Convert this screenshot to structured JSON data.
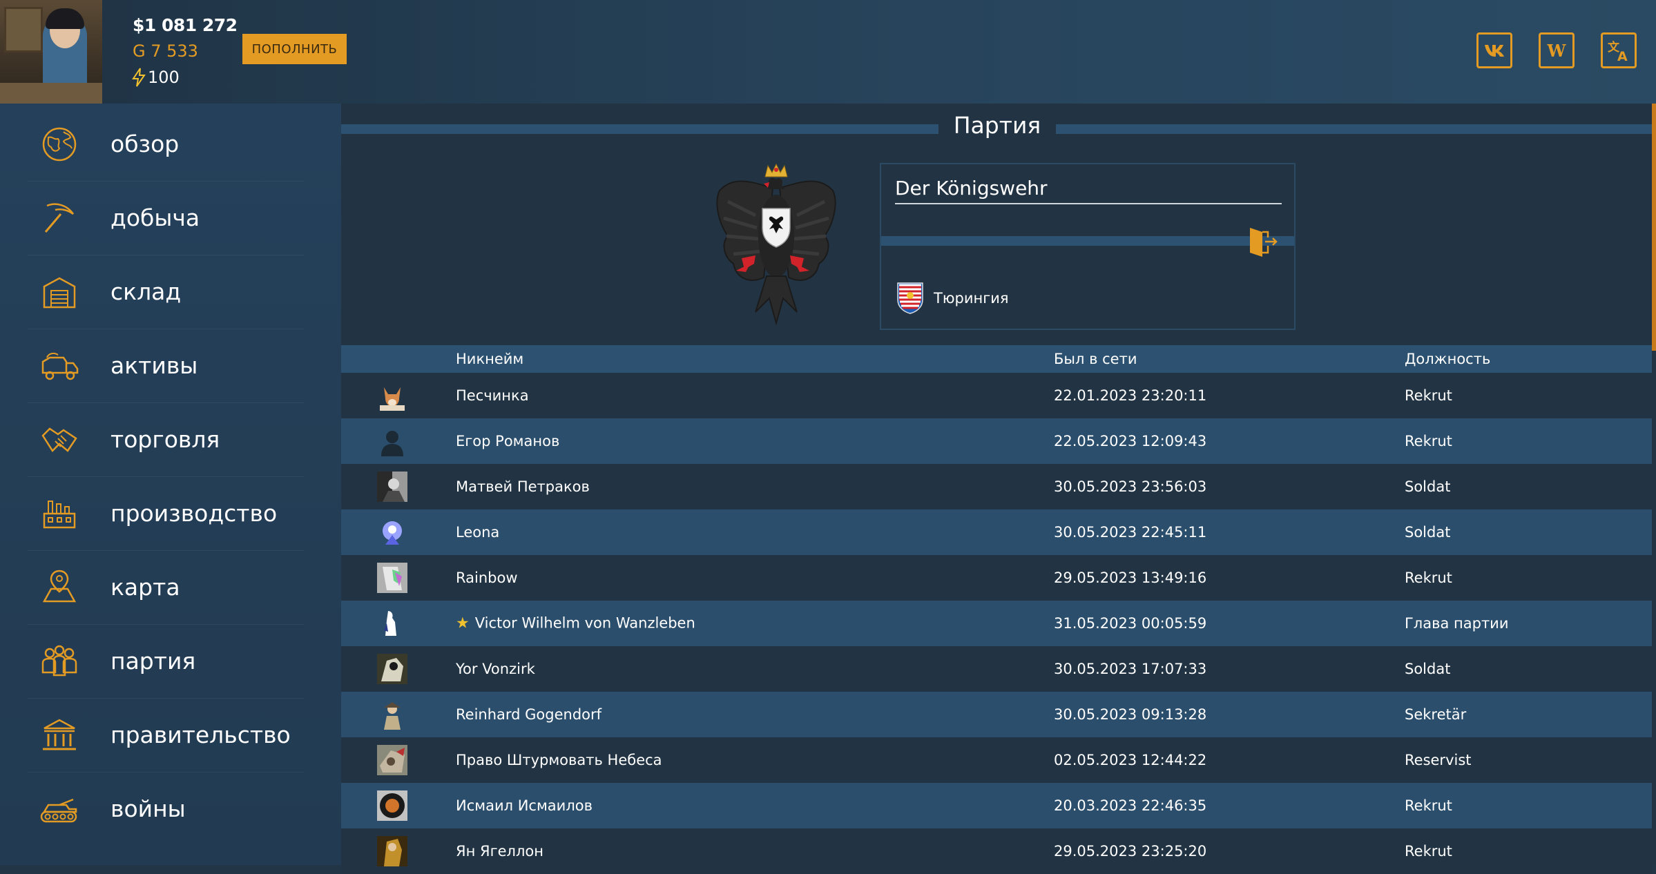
{
  "header": {
    "money": "$1 081 272",
    "gold": "G 7 533",
    "energy": "100",
    "topup_label": "ПОПОЛНИТЬ",
    "links": [
      {
        "icon": "vk-icon",
        "label": "VK"
      },
      {
        "icon": "wiki-icon",
        "label": "W"
      },
      {
        "icon": "translate-icon",
        "label": "文A"
      }
    ]
  },
  "sidebar": {
    "items": [
      {
        "label": "обзор",
        "icon": "globe-icon"
      },
      {
        "label": "добыча",
        "icon": "pickaxe-icon"
      },
      {
        "label": "склад",
        "icon": "warehouse-icon"
      },
      {
        "label": "активы",
        "icon": "truck-icon"
      },
      {
        "label": "торговля",
        "icon": "handshake-icon"
      },
      {
        "label": "производство",
        "icon": "factory-icon"
      },
      {
        "label": "карта",
        "icon": "map-icon"
      },
      {
        "label": "партия",
        "icon": "people-icon"
      },
      {
        "label": "правительство",
        "icon": "government-icon"
      },
      {
        "label": "войны",
        "icon": "tank-icon"
      }
    ]
  },
  "main": {
    "title": "Партия",
    "party": {
      "name": "Der Königswehr",
      "region": "Тюрингия"
    },
    "table": {
      "columns": [
        "Никнейм",
        "Был в сети",
        "Должность"
      ],
      "rows": [
        {
          "nick": "Песчинка",
          "last_seen": "22.01.2023 23:20:11",
          "role": "Rekrut",
          "leader": false
        },
        {
          "nick": "Егор Романов",
          "last_seen": "22.05.2023 12:09:43",
          "role": "Rekrut",
          "leader": false
        },
        {
          "nick": "Матвей Петраков",
          "last_seen": "30.05.2023 23:56:03",
          "role": "Soldat",
          "leader": false
        },
        {
          "nick": "Leona",
          "last_seen": "30.05.2023 22:45:11",
          "role": "Soldat",
          "leader": false
        },
        {
          "nick": "Rainbow",
          "last_seen": "29.05.2023 13:49:16",
          "role": "Rekrut",
          "leader": false
        },
        {
          "nick": "Victor Wilhelm von Wanzleben",
          "last_seen": "31.05.2023 00:05:59",
          "role": "Глава партии",
          "leader": true
        },
        {
          "nick": "Yor Vonzirk",
          "last_seen": "30.05.2023 17:07:33",
          "role": "Soldat",
          "leader": false
        },
        {
          "nick": "Reinhard Gogendorf",
          "last_seen": "30.05.2023 09:13:28",
          "role": "Sekretär",
          "leader": false
        },
        {
          "nick": "Право Штурмовать Небеса",
          "last_seen": "02.05.2023 12:44:22",
          "role": "Reservist",
          "leader": false
        },
        {
          "nick": "Исмаил Исмаилов",
          "last_seen": "20.03.2023 22:46:35",
          "role": "Rekrut",
          "leader": false
        },
        {
          "nick": "Ян Ягеллон",
          "last_seen": "29.05.2023 23:25:20",
          "role": "Rekrut",
          "leader": false
        }
      ]
    }
  },
  "colors": {
    "accent": "#e39b24",
    "background": "#223443",
    "band": "#2d5170",
    "row_alt": "#2b4e6c"
  }
}
